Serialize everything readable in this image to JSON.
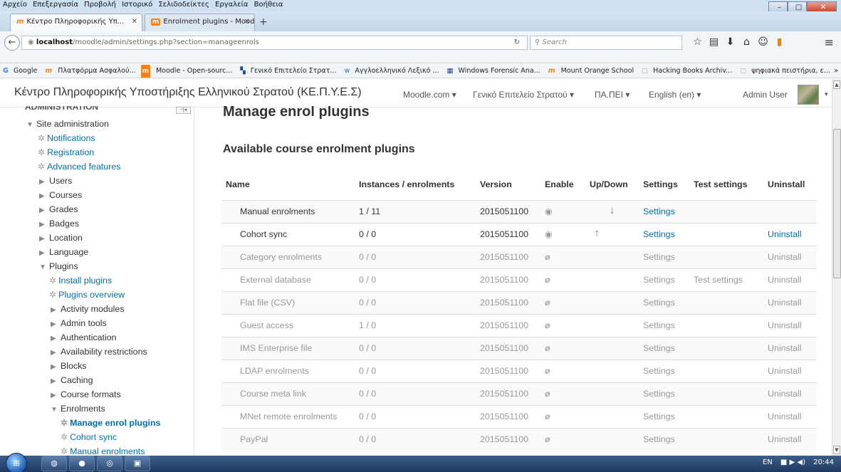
{
  "browser": {
    "menu": [
      "Αρχείο",
      "Επεξεργασία",
      "Προβολή",
      "Ιστορικό",
      "Σελιδοδείκτες",
      "Εργαλεία",
      "Βοήθεια"
    ],
    "tabs": [
      {
        "label": "Κέντρο Πληροφορικής Υπ...",
        "active": true
      },
      {
        "label": "Enrolment plugins - Moodl...",
        "active": false
      }
    ],
    "new_tab": "+",
    "url_host": "localhost",
    "url_path": "/moodle/admin/settings.php?section=manageenrols",
    "search_placeholder": "Search",
    "bookmarks": [
      "Google",
      "Πλατφόρμα Ασφαλού...",
      "Moodle - Open-sourc...",
      "Γενικό Επιτελείο Στρατ...",
      "Αγγλοελληνικό Λεξικό ...",
      "Windows Forensic Ana...",
      "Mount Orange School",
      "Hacking Books Archiv...",
      "ψηφιακά πειστήρια, ε..."
    ]
  },
  "moodle_header": {
    "site_name": "Κέντρο Πληροφορικής Υποστήριξης Ελληνικού Στρατού (ΚΕ.Π.Υ.Ε.Σ)",
    "menus": [
      "Moodle.com ▾",
      "Γενικό Επιτελείο Στρατού ▾",
      "ΠΑ.ΠΕΙ ▾",
      "English (en) ▾"
    ],
    "user": "Admin User"
  },
  "sidebar": {
    "heading": "ADMINISTRATION",
    "items": [
      {
        "label": "Site administration"
      },
      {
        "label": "Notifications"
      },
      {
        "label": "Registration"
      },
      {
        "label": "Advanced features"
      },
      {
        "label": "Users"
      },
      {
        "label": "Courses"
      },
      {
        "label": "Grades"
      },
      {
        "label": "Badges"
      },
      {
        "label": "Location"
      },
      {
        "label": "Language"
      },
      {
        "label": "Plugins"
      },
      {
        "label": "Install plugins"
      },
      {
        "label": "Plugins overview"
      },
      {
        "label": "Activity modules"
      },
      {
        "label": "Admin tools"
      },
      {
        "label": "Authentication"
      },
      {
        "label": "Availability restrictions"
      },
      {
        "label": "Blocks"
      },
      {
        "label": "Caching"
      },
      {
        "label": "Course formats"
      },
      {
        "label": "Enrolments"
      },
      {
        "label": "Manage enrol plugins"
      },
      {
        "label": "Cohort sync"
      },
      {
        "label": "Manual enrolments"
      }
    ]
  },
  "main": {
    "title": "Manage enrol plugins",
    "subtitle": "Available course enrolment plugins",
    "columns": [
      "Name",
      "Instances / enrolments",
      "Version",
      "Enable",
      "Up/Down",
      "Settings",
      "Test settings",
      "Uninstall"
    ],
    "rows": [
      {
        "name": "Manual enrolments",
        "instances": "1 / 11",
        "version": "2015051100",
        "settings": "Settings",
        "test": "",
        "uninstall": ""
      },
      {
        "name": "Cohort sync",
        "instances": "0 / 0",
        "version": "2015051100",
        "settings": "Settings",
        "test": "",
        "uninstall": "Uninstall"
      },
      {
        "name": "Category enrolments",
        "instances": "0 / 0",
        "version": "2015051100",
        "settings": "Settings",
        "test": "",
        "uninstall": "Uninstall"
      },
      {
        "name": "External database",
        "instances": "0 / 0",
        "version": "2015051100",
        "settings": "Settings",
        "test": "Test settings",
        "uninstall": "Uninstall"
      },
      {
        "name": "Flat file (CSV)",
        "instances": "0 / 0",
        "version": "2015051100",
        "settings": "Settings",
        "test": "",
        "uninstall": "Uninstall"
      },
      {
        "name": "Guest access",
        "instances": "1 / 0",
        "version": "2015051100",
        "settings": "Settings",
        "test": "",
        "uninstall": "Uninstall"
      },
      {
        "name": "IMS Enterprise file",
        "instances": "0 / 0",
        "version": "2015051100",
        "settings": "Settings",
        "test": "",
        "uninstall": "Uninstall"
      },
      {
        "name": "LDAP enrolments",
        "instances": "0 / 0",
        "version": "2015051100",
        "settings": "Settings",
        "test": "",
        "uninstall": "Uninstall"
      },
      {
        "name": "Course meta link",
        "instances": "0 / 0",
        "version": "2015051100",
        "settings": "Settings",
        "test": "",
        "uninstall": "Uninstall"
      },
      {
        "name": "MNet remote enrolments",
        "instances": "0 / 0",
        "version": "2015051100",
        "settings": "Settings",
        "test": "",
        "uninstall": "Uninstall"
      },
      {
        "name": "PayPal",
        "instances": "0 / 0",
        "version": "2015051100",
        "settings": "Settings",
        "test": "",
        "uninstall": "Uninstall"
      }
    ]
  },
  "taskbar": {
    "lang": "EN",
    "time": "20:44"
  },
  "colors": {
    "link": "#0070a8",
    "dimmed": "#999999",
    "moodle_orange": "#f98012"
  }
}
